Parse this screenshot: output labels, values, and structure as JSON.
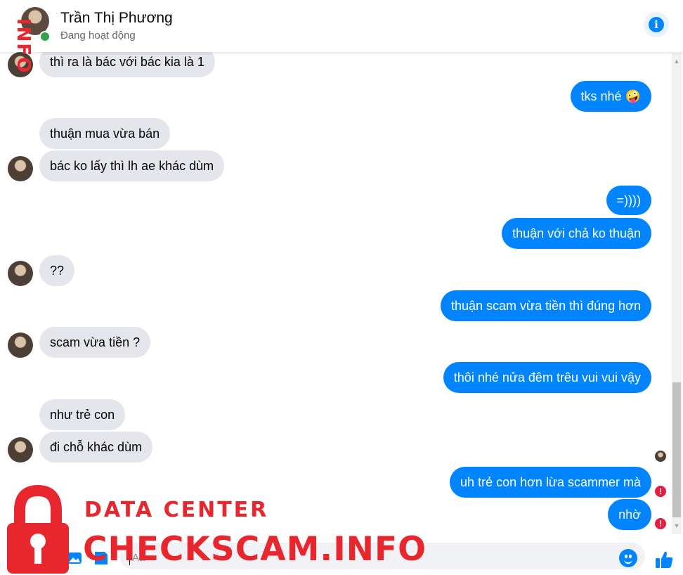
{
  "header": {
    "contact_name": "Trần Thị Phương",
    "status": "Đang hoạt động",
    "info_icon": "info-icon",
    "online_color": "#31a24c"
  },
  "messages": [
    {
      "side": "in",
      "text": "thì ra là bác với bác kia là 1"
    },
    {
      "side": "out",
      "text": "tks nhé",
      "emoji": "🤪"
    },
    {
      "side": "in",
      "text": "thuận mua vừa bán"
    },
    {
      "side": "in",
      "text": "bác ko lấy thì lh ae khác dùm"
    },
    {
      "side": "out",
      "text": "=))))"
    },
    {
      "side": "out",
      "text": "thuận với chả ko thuận"
    },
    {
      "side": "in",
      "text": "??"
    },
    {
      "side": "out",
      "text": "thuận scam vừa tiền thì đúng hơn"
    },
    {
      "side": "in",
      "text": "scam vừa tiền ?"
    },
    {
      "side": "out",
      "text": "thôi nhé nửa đêm trêu vui vui vậy"
    },
    {
      "side": "in",
      "text": "như trẻ con"
    },
    {
      "side": "in",
      "text": "đi chỗ khác dùm"
    },
    {
      "side": "out",
      "text": "uh trẻ con hơn lừa scammer mà",
      "status": "error"
    },
    {
      "side": "out",
      "text": "nhờ",
      "status": "error"
    }
  ],
  "send_error_mark": "!",
  "composer": {
    "placeholder": "Aa",
    "icons": [
      "plus-icon",
      "image-icon",
      "sticker-icon",
      "gif-icon",
      "emoji-icon",
      "like-icon"
    ]
  },
  "watermark": {
    "line1": "DATA CENTER",
    "line2": "CHECKSCAM.INFO",
    "corner_text": "INFO",
    "color": "#e8262d"
  },
  "colors": {
    "outgoing": "#0084ff",
    "incoming": "#e4e6eb",
    "error": "#e41e3f"
  }
}
